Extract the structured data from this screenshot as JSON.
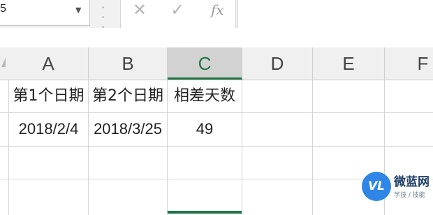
{
  "formula_bar": {
    "name_box_value": "5",
    "name_box_dropdown_icon": "chevron-down-icon",
    "separator_icon": "vertical-dots-icon",
    "cancel_icon_glyph": "✕",
    "enter_icon_glyph": "✓",
    "function_label": "fx",
    "formula_value": ""
  },
  "columns": [
    "A",
    "B",
    "C",
    "D",
    "E",
    "F"
  ],
  "selected_column": "C",
  "rows": [
    [
      "第1个日期",
      "第2个日期",
      "相差天数",
      "",
      "",
      ""
    ],
    [
      "2018/2/4",
      "2018/3/25",
      "49",
      "",
      "",
      ""
    ]
  ],
  "watermark": {
    "logo_text": "VL",
    "title": "微蓝网",
    "subtitle": "学技 / 技能"
  },
  "colors": {
    "selection_accent": "#217346",
    "header_background": "#f0f0f0",
    "gridline": "#d4d4d4",
    "watermark_blue": "#2f86e6"
  }
}
